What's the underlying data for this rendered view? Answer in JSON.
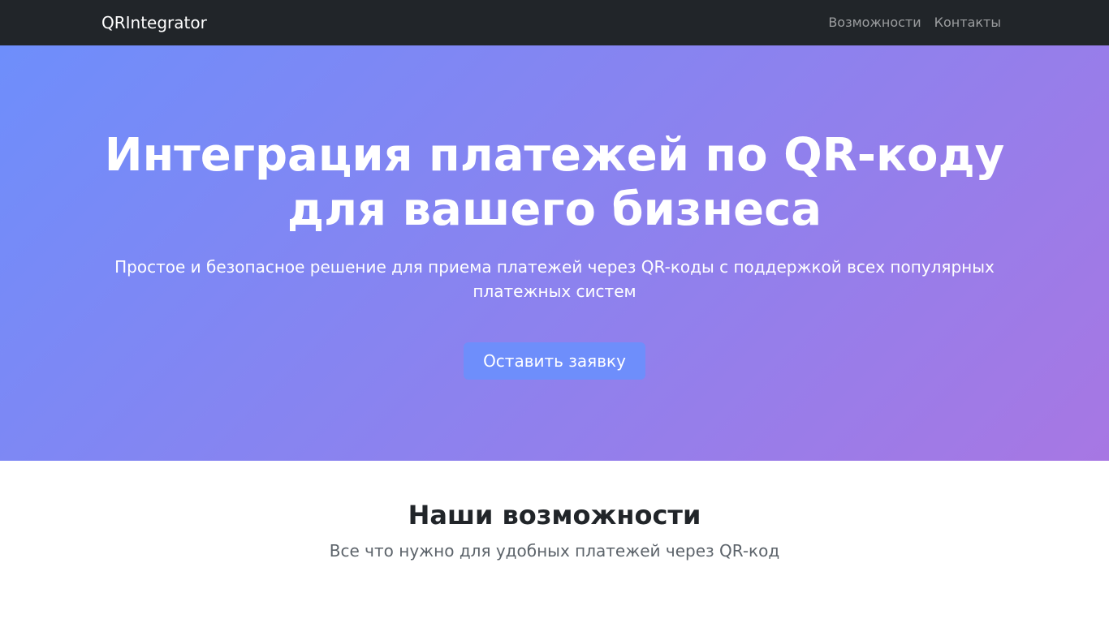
{
  "navbar": {
    "brand": "QRIntegrator",
    "links": [
      {
        "label": "Возможности"
      },
      {
        "label": "Контакты"
      }
    ]
  },
  "hero": {
    "title_lines": [
      "Интеграция платежей по QR-коду",
      "для вашего бизнеса"
    ],
    "subtitle_lines": [
      "Простое и безопасное решение для приема платежей через QR-коды с поддержкой всех популярных",
      "платежных систем"
    ],
    "cta_label": "Оставить заявку"
  },
  "features": {
    "title": "Наши возможности",
    "subtitle": "Все что нужно для удобных платежей через QR-код"
  },
  "colors": {
    "navbar_bg": "#212529",
    "gradient_start": "#6e8efb",
    "gradient_end": "#a777e3",
    "button_bg": "#6e8efb"
  }
}
